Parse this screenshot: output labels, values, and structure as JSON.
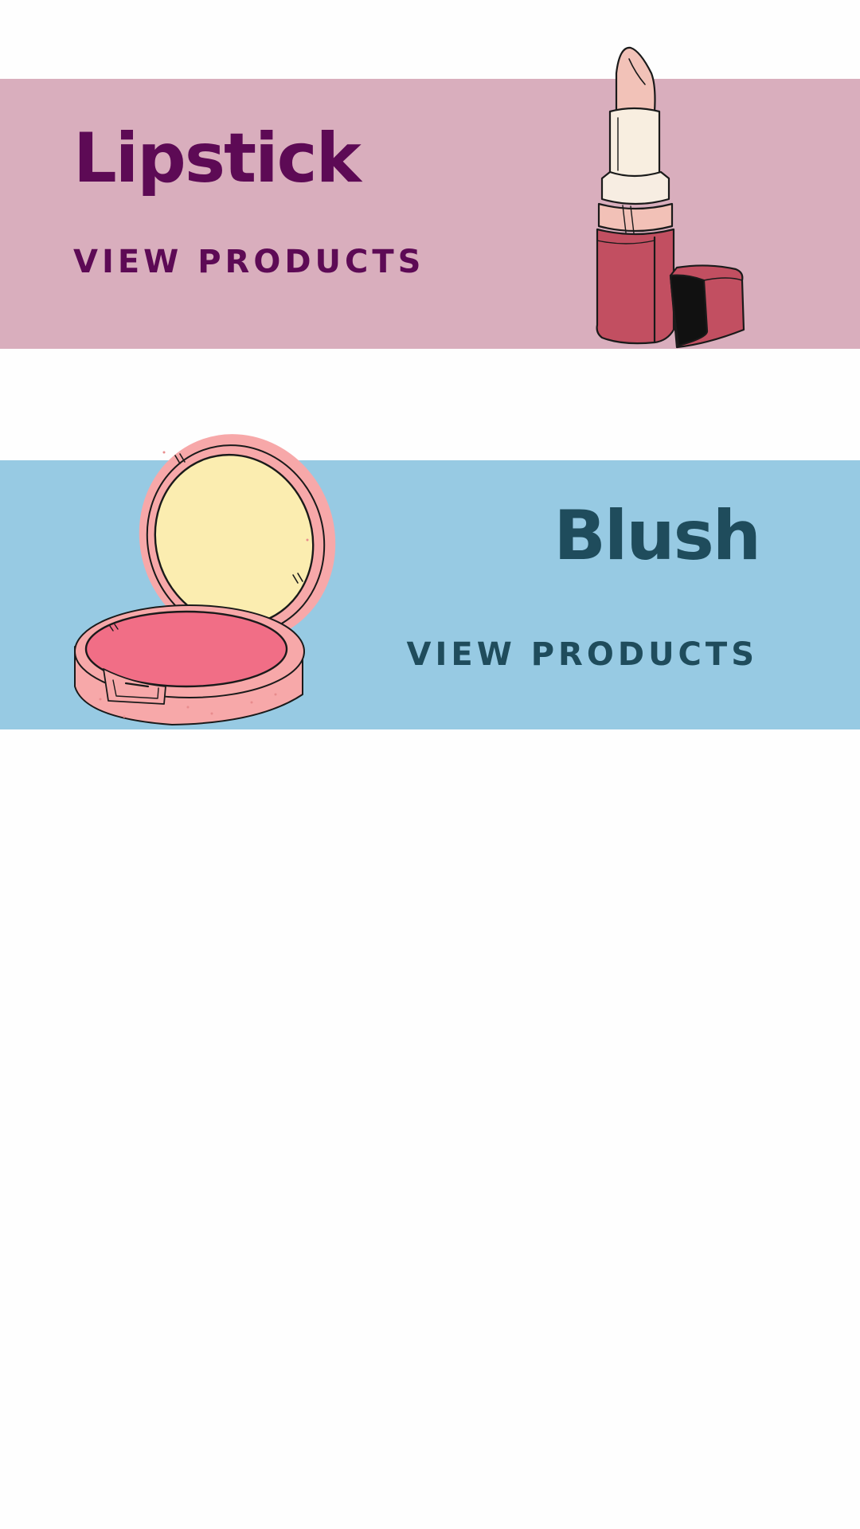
{
  "sections": [
    {
      "id": "lipstick",
      "title": "Lipstick",
      "cta_label": "VIEW PRODUCTS",
      "icon": "lipstick-illustration",
      "background": "#d9aebd",
      "text_color": "#5d0a55"
    },
    {
      "id": "blush",
      "title": "Blush",
      "cta_label": "VIEW PRODUCTS",
      "icon": "blush-compact-illustration",
      "background": "#97cae3",
      "text_color": "#1f4c5c"
    }
  ]
}
